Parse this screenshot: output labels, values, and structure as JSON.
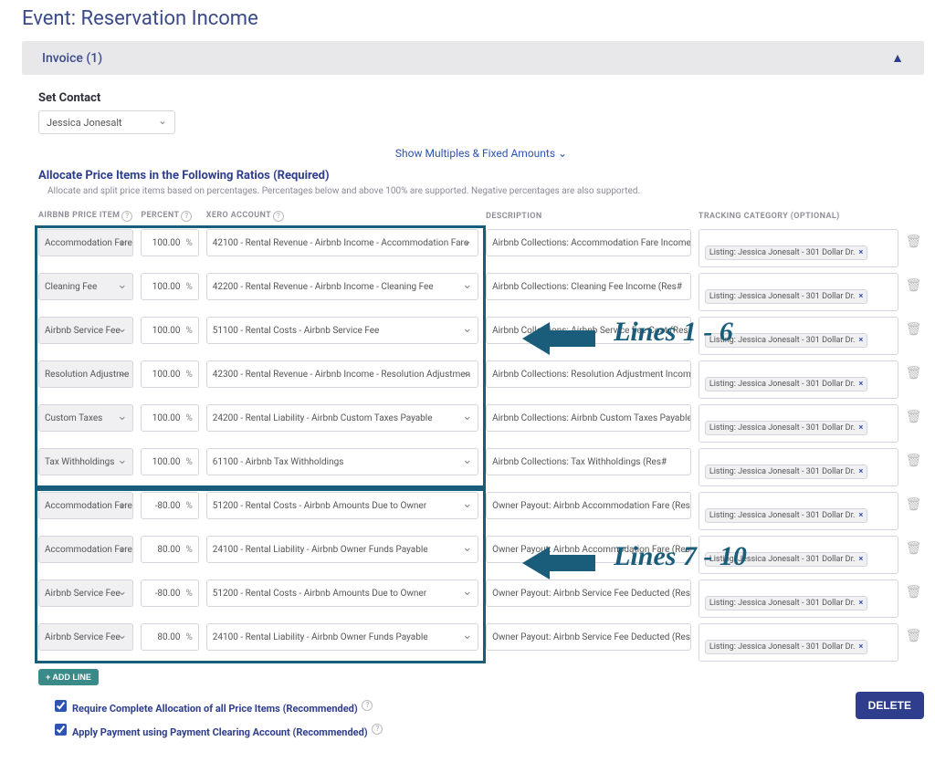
{
  "title": "Event: Reservation Income",
  "invoice_header": "Invoice (1)",
  "set_contact_label": "Set Contact",
  "contact_value": "Jessica Jonesalt",
  "multiples_link": "Show Multiples & Fixed Amounts",
  "allocate_heading": "Allocate Price Items in the Following Ratios (Required)",
  "allocate_sub": "Allocate and split price items based on percentages. Percentages below and above 100% are supported. Negative percentages are also supported.",
  "columns": {
    "item": "AIRBNB PRICE ITEM",
    "percent": "PERCENT",
    "account": "XERO ACCOUNT",
    "description": "DESCRIPTION",
    "tracking": "TRACKING CATEGORY (OPTIONAL)"
  },
  "rows": [
    {
      "item": "Accommodation Fare",
      "pct": "100.00",
      "acct": "42100 - Rental Revenue - Airbnb Income - Accommodation Fare",
      "desc": "Airbnb Collections: Accommodation Fare Income",
      "tag": "Listing: Jessica Jonesalt - 301 Dollar Dr."
    },
    {
      "item": "Cleaning Fee",
      "pct": "100.00",
      "acct": "42200 - Rental Revenue - Airbnb Income - Cleaning Fee",
      "desc": "Airbnb Collections: Cleaning Fee Income (Res#",
      "tag": "Listing: Jessica Jonesalt - 301 Dollar Dr."
    },
    {
      "item": "Airbnb Service Fee",
      "pct": "100.00",
      "acct": "51100 - Rental Costs - Airbnb Service Fee",
      "desc": "Airbnb Collections: Airbnb Service Fee Cost (Res#",
      "tag": "Listing: Jessica Jonesalt - 301 Dollar Dr."
    },
    {
      "item": "Resolution Adjustme",
      "pct": "100.00",
      "acct": "42300 - Rental Revenue - Airbnb Income - Resolution Adjustmen",
      "desc": "Airbnb Collections: Resolution Adjustment Income",
      "tag": "Listing: Jessica Jonesalt - 301 Dollar Dr."
    },
    {
      "item": "Custom Taxes",
      "pct": "100.00",
      "acct": "24200 - Rental Liability - Airbnb Custom Taxes Payable",
      "desc": "Airbnb Collections: Airbnb Custom Taxes Payable",
      "tag": "Listing: Jessica Jonesalt - 301 Dollar Dr."
    },
    {
      "item": "Tax Withholdings",
      "pct": "100.00",
      "acct": "61100 - Airbnb Tax Withholdings",
      "desc": "Airbnb Collections: Tax Withholdings (Res#",
      "tag": "Listing: Jessica Jonesalt - 301 Dollar Dr."
    },
    {
      "item": "Accommodation Fare",
      "pct": "-80.00",
      "acct": "51200 - Rental Costs - Airbnb Amounts Due to Owner",
      "desc": "Owner Payout: Airbnb Accommodation Fare (Res#",
      "tag": "Listing: Jessica Jonesalt - 301 Dollar Dr."
    },
    {
      "item": "Accommodation Fare",
      "pct": "80.00",
      "acct": "24100 - Rental Liability - Airbnb Owner Funds Payable",
      "desc": "Owner Payout: Airbnb Accommodation Fare (Res#",
      "tag": "Listing: Jessica Jonesalt - 301 Dollar Dr."
    },
    {
      "item": "Airbnb Service Fee",
      "pct": "-80.00",
      "acct": "51200 - Rental Costs - Airbnb Amounts Due to Owner",
      "desc": "Owner Payout: Airbnb Service Fee Deducted (Res#",
      "tag": "Listing: Jessica Jonesalt - 301 Dollar Dr."
    },
    {
      "item": "Airbnb Service Fee",
      "pct": "80.00",
      "acct": "24100 - Rental Liability - Airbnb Owner Funds Payable",
      "desc": "Owner Payout: Airbnb Service Fee Deducted (Res#",
      "tag": "Listing: Jessica Jonesalt - 301 Dollar Dr."
    }
  ],
  "add_line": "+ ADD LINE",
  "check1": "Require Complete Allocation of all Price Items (Recommended)",
  "check2": "Apply Payment using Payment Clearing Account (Recommended)",
  "delete_btn": "DELETE",
  "annot1": "Lines 1 - 6",
  "annot2": "Lines 7 - 10"
}
